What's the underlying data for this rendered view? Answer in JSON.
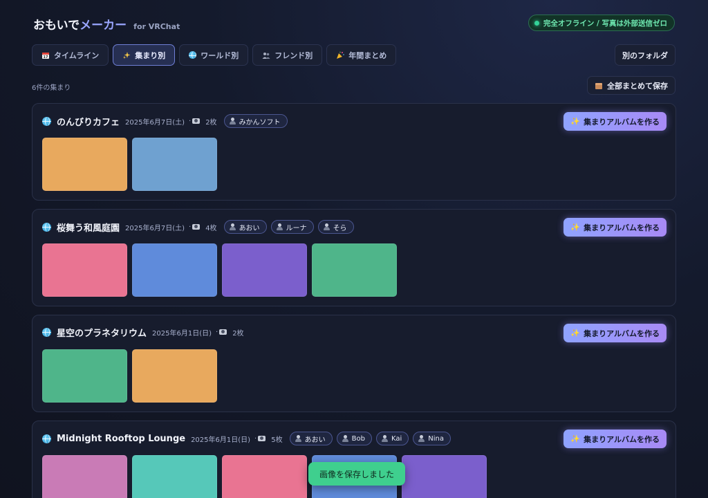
{
  "header": {
    "title_main": "おもいで",
    "title_accent": "メーカー",
    "title_sub": "for VRChat",
    "offline_badge": "完全オフライン / 写真は外部送信ゼロ"
  },
  "tabs": [
    {
      "label": "タイムライン",
      "icon": "calendar-icon",
      "active": false
    },
    {
      "label": "集まり別",
      "icon": "sparkle-icon",
      "active": true
    },
    {
      "label": "ワールド別",
      "icon": "globe-icon",
      "active": false
    },
    {
      "label": "フレンド別",
      "icon": "people-icon",
      "active": false
    },
    {
      "label": "年間まとめ",
      "icon": "party-popper-icon",
      "active": false
    }
  ],
  "toolbar": {
    "folder_button": "別のフォルダ",
    "count_label": "6件の集まり",
    "save_all_button": "全部まとめて保存"
  },
  "album_button_label": "集まりアルバムを作る",
  "gatherings": [
    {
      "world": "のんびりカフェ",
      "date": "2025年6月7日(土)",
      "photo_count": "2枚",
      "friends": [
        "みかんソフト"
      ],
      "thumb_colors": [
        "#e8a95e",
        "#6fa1d0"
      ]
    },
    {
      "world": "桜舞う和風庭園",
      "date": "2025年6月7日(土)",
      "photo_count": "4枚",
      "friends": [
        "あおい",
        "ルーナ",
        "そら"
      ],
      "thumb_colors": [
        "#e97492",
        "#5f8bdb",
        "#7b5fcc",
        "#4fb58a"
      ]
    },
    {
      "world": "星空のプラネタリウム",
      "date": "2025年6月1日(日)",
      "photo_count": "2枚",
      "friends": [],
      "thumb_colors": [
        "#4fb58a",
        "#e8a95e"
      ]
    },
    {
      "world": "Midnight Rooftop Lounge",
      "date": "2025年6月1日(日)",
      "photo_count": "5枚",
      "friends": [
        "あおい",
        "Bob",
        "Kai",
        "Nina"
      ],
      "thumb_colors": [
        "#c97bb6",
        "#56c8b9",
        "#e97492",
        "#5f8bdb",
        "#7b5fcc"
      ]
    }
  ],
  "toast": "画像を保存しました"
}
